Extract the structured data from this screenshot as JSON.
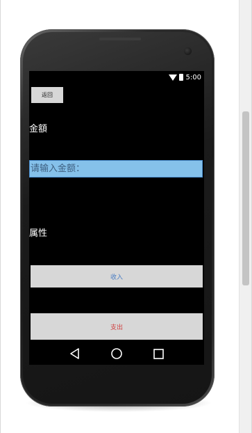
{
  "status_bar": {
    "time": "5:00"
  },
  "header": {
    "back_label": "返回"
  },
  "form": {
    "amount_label": "金額",
    "amount_placeholder": "请输入金额：",
    "attribute_label": "属性"
  },
  "actions": {
    "income_label": "收入",
    "expense_label": "支出"
  },
  "navigation": {
    "icons": [
      "back-icon",
      "home-icon",
      "recents-icon"
    ]
  },
  "colors": {
    "input_background": "#85c1ea",
    "income_text": "#4c7fc4",
    "expense_text": "#d04040",
    "button_background": "#d7d7d7"
  }
}
